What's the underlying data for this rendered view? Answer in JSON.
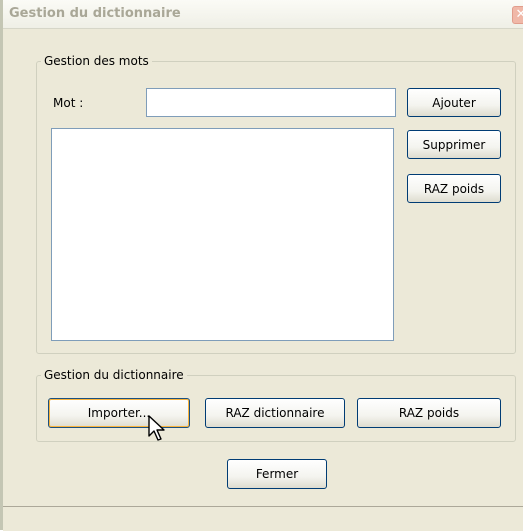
{
  "window": {
    "title": "Gestion du dictionnaire",
    "close_glyph": "✕"
  },
  "words_group": {
    "legend": "Gestion des mots",
    "mot_label": "Mot :",
    "mot_value": "",
    "buttons": {
      "ajouter": "Ajouter",
      "supprimer": "Supprimer",
      "raz_poids": "RAZ poids"
    },
    "word_list": []
  },
  "dict_group": {
    "legend": "Gestion du dictionnaire",
    "buttons": {
      "importer": "Importer...",
      "raz_dictionnaire": "RAZ dictionnaire",
      "raz_poids": "RAZ poids"
    }
  },
  "footer": {
    "fermer": "Fermer"
  },
  "colors": {
    "panel": "#ece9d8",
    "button_border": "#003c74",
    "input_border": "#7f9db9",
    "title_text": "#a9a797"
  },
  "icons": {
    "cursor": "arrow-pointer-icon",
    "close": "close-icon"
  }
}
